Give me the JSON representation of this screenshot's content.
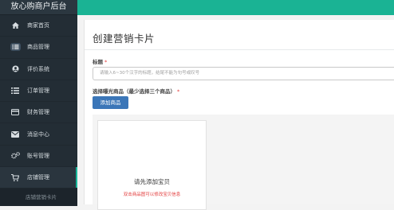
{
  "app": {
    "title": "放心购商户后台"
  },
  "sidebar": {
    "items": [
      {
        "label": "商家首页",
        "icon": "home-icon"
      },
      {
        "label": "商品管理",
        "icon": "list-icon"
      },
      {
        "label": "评价系统",
        "icon": "user-circle-icon"
      },
      {
        "label": "订单管理",
        "icon": "list-icon"
      },
      {
        "label": "财务管理",
        "icon": "credit-card-icon"
      },
      {
        "label": "消息中心",
        "icon": "envelope-icon"
      },
      {
        "label": "账号管理",
        "icon": "gears-icon"
      },
      {
        "label": "店铺管理",
        "icon": "cart-icon"
      }
    ],
    "sub_item": "店铺营销卡片"
  },
  "page": {
    "title": "创建营销卡片",
    "title_field": {
      "label": "标题",
      "required_mark": "*",
      "placeholder": "请输入6~30个汉字的标题，结尾不能为句号或叹号"
    },
    "products_field": {
      "label": "选择曝光商品（最少选择三个商品）",
      "required_mark": "*",
      "add_button": "添加商品"
    },
    "card": {
      "empty_text": "请先添加宝贝",
      "hint": "双击商品图可以修改宝贝信息"
    }
  },
  "colors": {
    "accent": "#1ab394",
    "sidebar": "#232d35",
    "primary_button": "#3b76b8",
    "required": "#e23b3b"
  }
}
